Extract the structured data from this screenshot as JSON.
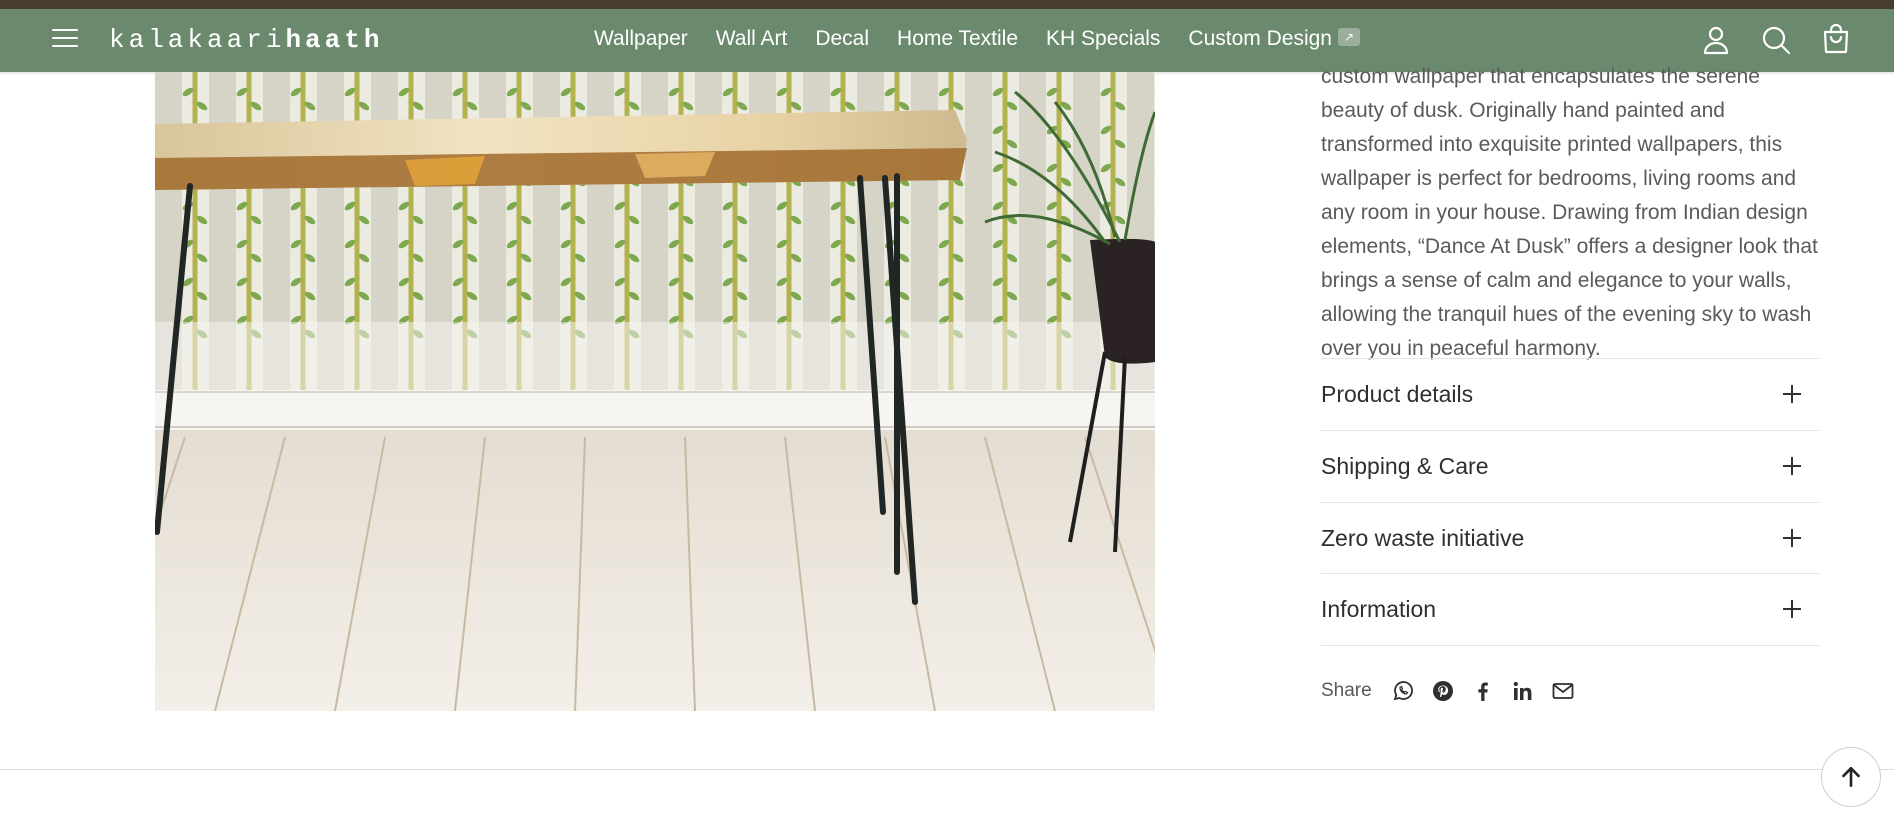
{
  "header": {
    "logo_light": "kalakaari",
    "logo_bold": "haath",
    "nav": [
      {
        "label": "Wallpaper"
      },
      {
        "label": "Wall Art"
      },
      {
        "label": "Decal"
      },
      {
        "label": "Home Textile"
      },
      {
        "label": "KH Specials"
      },
      {
        "label": "Custom Design"
      }
    ],
    "external_badge": "↗"
  },
  "product": {
    "description": "custom wallpaper that encapsulates the serene beauty of dusk. Originally hand painted and transformed into exquisite printed wallpapers, this wallpaper is perfect for bedrooms, living rooms and any room in your house. Drawing from Indian design elements, “Dance At Dusk” offers a designer look that brings a sense of calm and elegance to your walls, allowing the tranquil hues of the evening sky to wash over you in peaceful harmony.",
    "accordions": [
      {
        "label": "Product details"
      },
      {
        "label": "Shipping & Care"
      },
      {
        "label": "Zero waste initiative"
      },
      {
        "label": "Information"
      }
    ],
    "share_label": "Share",
    "share_icons": [
      "whatsapp-icon",
      "pinterest-icon",
      "facebook-icon",
      "linkedin-icon",
      "email-icon"
    ]
  },
  "colors": {
    "header_bg": "#6b8a6d",
    "top_strip": "#4a3d2f",
    "text": "#5a5a5a"
  }
}
